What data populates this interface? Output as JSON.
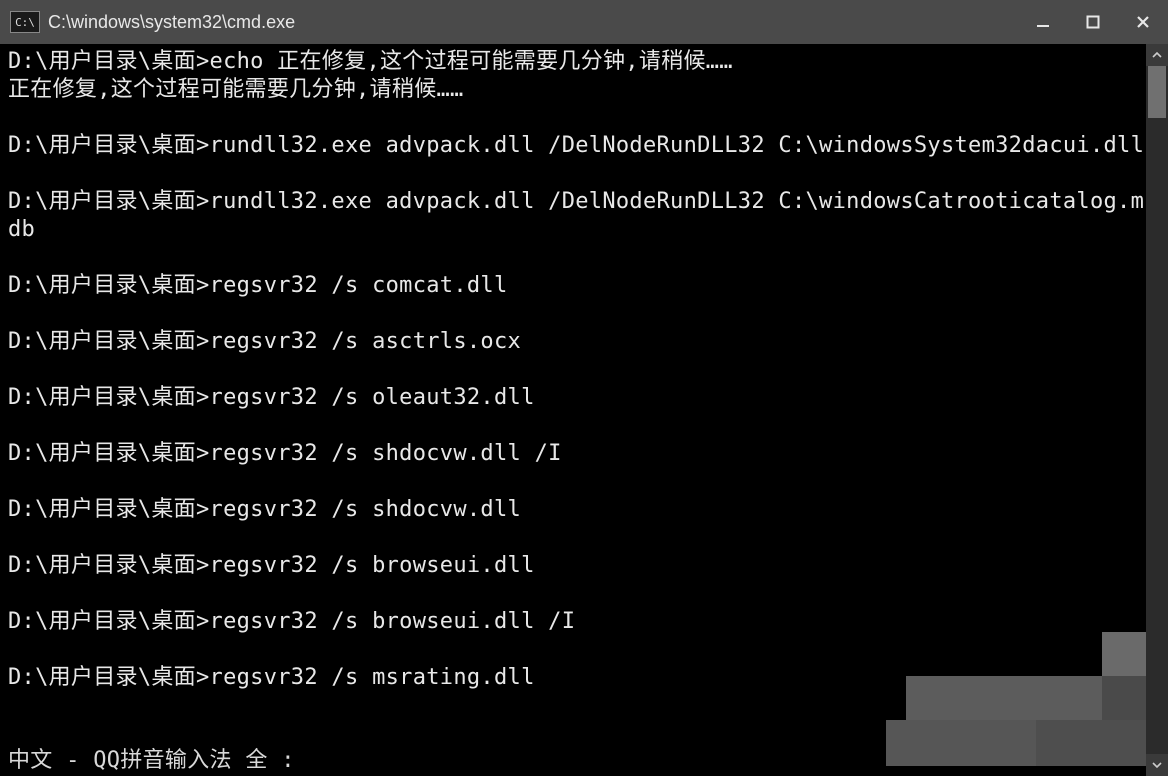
{
  "titlebar": {
    "icon_text": "C:\\",
    "title": "C:\\windows\\system32\\cmd.exe"
  },
  "prompt": "D:\\用户目录\\桌面>",
  "terminal": {
    "lines": [
      {
        "t": "cmd",
        "cmd": "echo 正在修复,这个过程可能需要几分钟,请稍候……"
      },
      {
        "t": "out",
        "text": "正在修复,这个过程可能需要几分钟,请稍候……"
      },
      {
        "t": "blank"
      },
      {
        "t": "cmd",
        "cmd": "rundll32.exe advpack.dll /DelNodeRunDLL32 C:\\windowsSystem32dacui.dll"
      },
      {
        "t": "blank"
      },
      {
        "t": "cmd",
        "cmd": "rundll32.exe advpack.dll /DelNodeRunDLL32 C:\\windowsCatrooticatalog.mdb"
      },
      {
        "t": "blank"
      },
      {
        "t": "cmd",
        "cmd": "regsvr32 /s comcat.dll"
      },
      {
        "t": "blank"
      },
      {
        "t": "cmd",
        "cmd": "regsvr32 /s asctrls.ocx"
      },
      {
        "t": "blank"
      },
      {
        "t": "cmd",
        "cmd": "regsvr32 /s oleaut32.dll"
      },
      {
        "t": "blank"
      },
      {
        "t": "cmd",
        "cmd": "regsvr32 /s shdocvw.dll /I"
      },
      {
        "t": "blank"
      },
      {
        "t": "cmd",
        "cmd": "regsvr32 /s shdocvw.dll"
      },
      {
        "t": "blank"
      },
      {
        "t": "cmd",
        "cmd": "regsvr32 /s browseui.dll"
      },
      {
        "t": "blank"
      },
      {
        "t": "cmd",
        "cmd": "regsvr32 /s browseui.dll /I"
      },
      {
        "t": "blank"
      },
      {
        "t": "cmd",
        "cmd": "regsvr32 /s msrating.dll"
      }
    ]
  },
  "ime": {
    "text": "中文 - QQ拼音输入法 全 :"
  }
}
